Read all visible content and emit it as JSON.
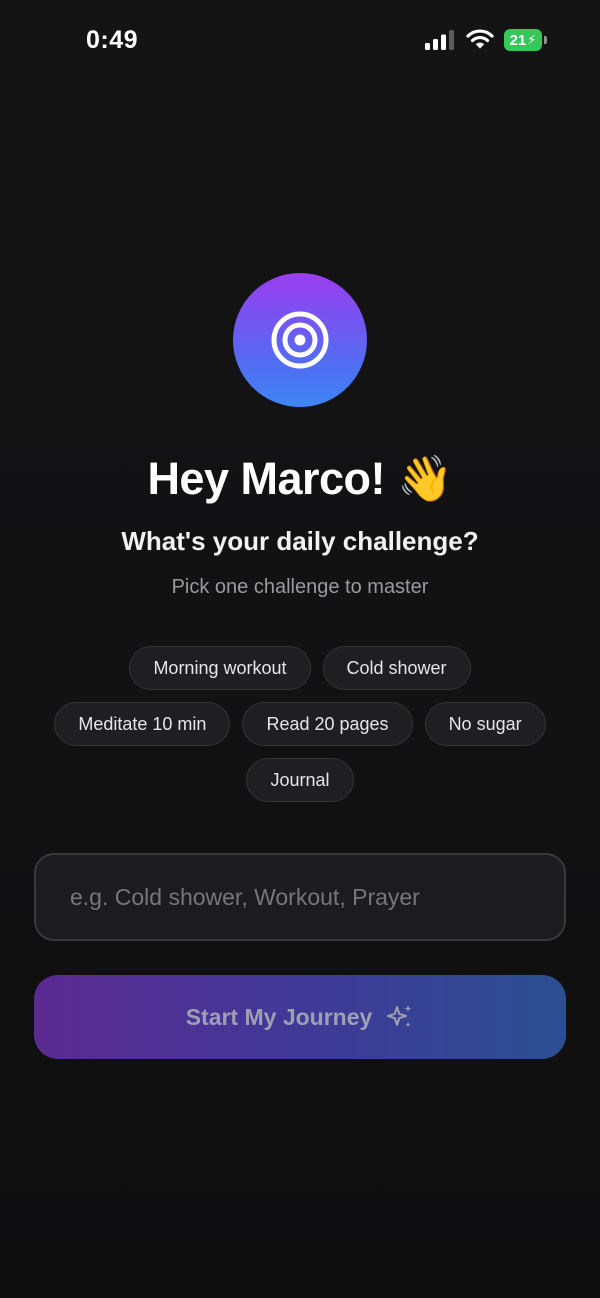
{
  "status_bar": {
    "time": "0:49",
    "battery_level": "21",
    "battery_color": "#34c759",
    "icons": [
      "signal-bars-icon",
      "wifi-icon",
      "battery-charging-icon"
    ]
  },
  "logo": {
    "icon": "target-icon",
    "gradient": [
      "#9b3df0",
      "#3f86f5"
    ]
  },
  "greeting": "Hey Marco! 👋",
  "question": "What's your daily challenge?",
  "hint": "Pick one challenge to master",
  "suggestions": [
    [
      "Morning workout",
      "Cold shower"
    ],
    [
      "Meditate 10 min",
      "Read 20 pages",
      "No sugar"
    ],
    [
      "Journal"
    ]
  ],
  "challenge_input": {
    "value": "",
    "placeholder": "e.g. Cold shower, Workout, Prayer"
  },
  "start_button": {
    "label": "Start My Journey",
    "icon": "sparkles-icon",
    "gradient": [
      "#5b2a91",
      "#2b4f91"
    ]
  }
}
